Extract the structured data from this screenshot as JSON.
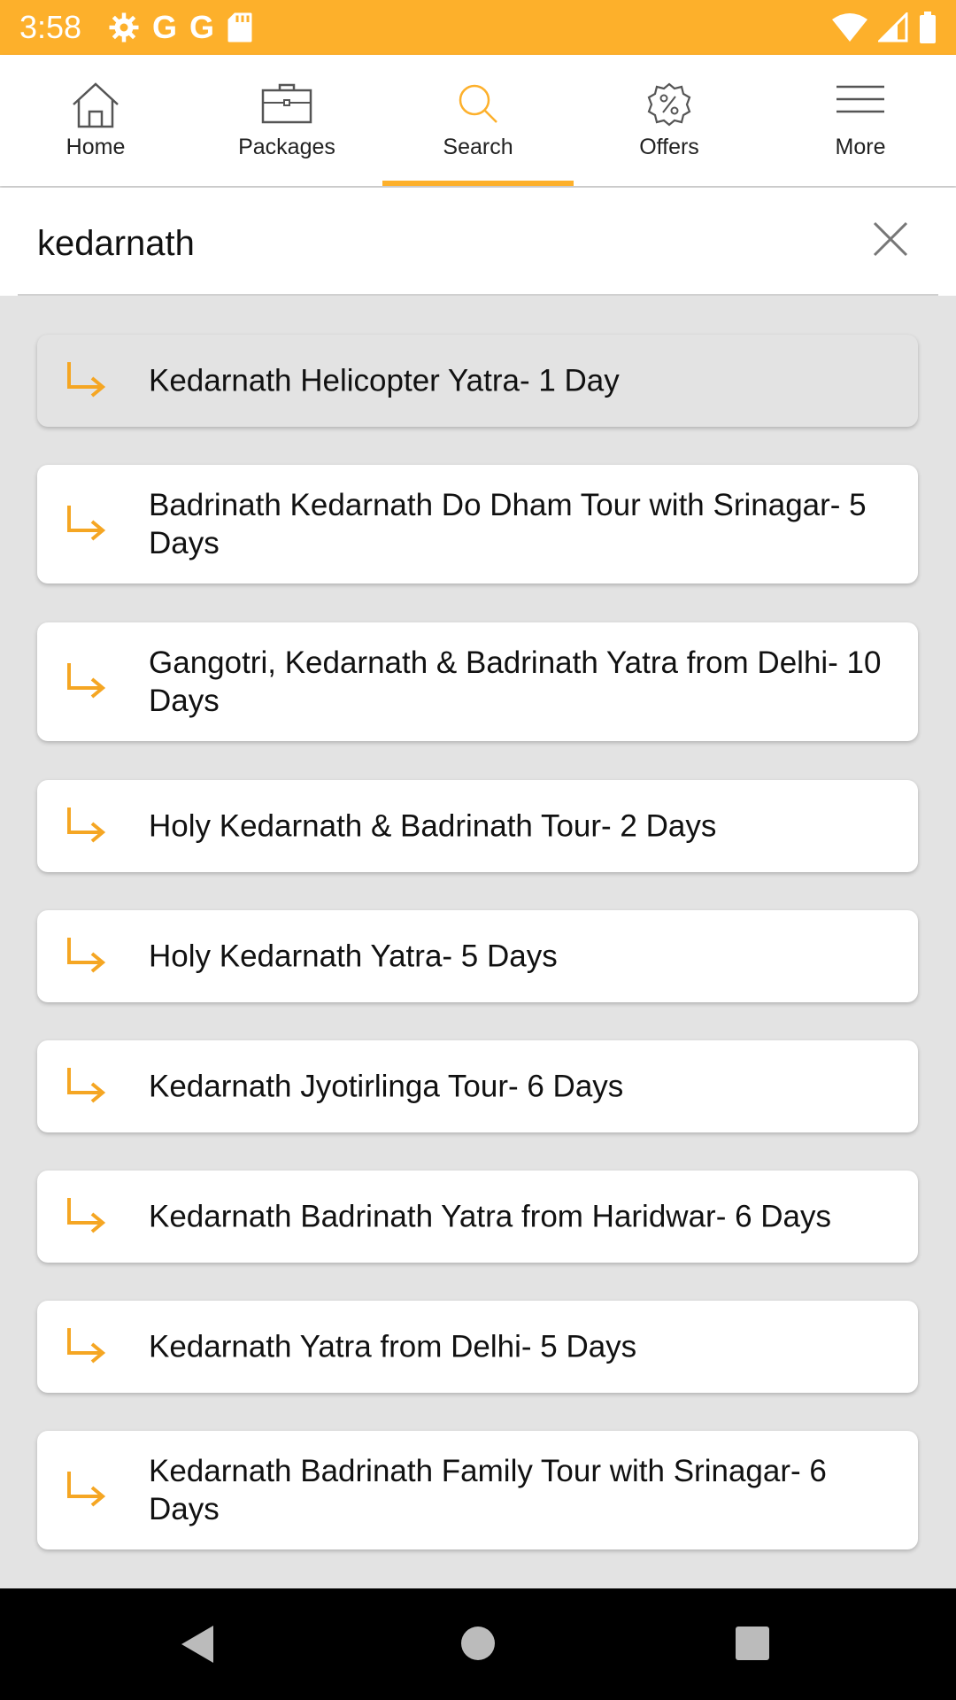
{
  "status_bar": {
    "time": "3:58",
    "left_icons": [
      "gear-icon",
      "G",
      "G",
      "sd-card-icon"
    ],
    "right_icons": [
      "wifi-icon",
      "signal-icon",
      "battery-icon"
    ]
  },
  "nav": {
    "accent_color": "#FDB02B",
    "tabs": [
      {
        "label": "Home",
        "icon": "home-icon"
      },
      {
        "label": "Packages",
        "icon": "briefcase-icon"
      },
      {
        "label": "Search",
        "icon": "search-icon",
        "active": true
      },
      {
        "label": "Offers",
        "icon": "offers-badge-icon"
      },
      {
        "label": "More",
        "icon": "menu-icon"
      }
    ]
  },
  "search": {
    "value": "kedarnath",
    "clear_icon": "close-icon"
  },
  "results": [
    {
      "label": "Kedarnath Helicopter Yatra- 1 Day",
      "highlighted": true
    },
    {
      "label": "Badrinath Kedarnath Do Dham Tour with Srinagar- 5 Days"
    },
    {
      "label": "Gangotri, Kedarnath & Badrinath Yatra from Delhi- 10 Days"
    },
    {
      "label": "Holy Kedarnath & Badrinath Tour- 2 Days"
    },
    {
      "label": "Holy Kedarnath Yatra- 5 Days"
    },
    {
      "label": "Kedarnath Jyotirlinga Tour- 6 Days"
    },
    {
      "label": "Kedarnath Badrinath Yatra from Haridwar- 6 Days"
    },
    {
      "label": "Kedarnath Yatra from Delhi- 5 Days"
    },
    {
      "label": "Kedarnath Badrinath Family Tour with Srinagar- 6 Days"
    }
  ],
  "android_nav": [
    "back-icon",
    "home-circle-icon",
    "recents-icon"
  ]
}
